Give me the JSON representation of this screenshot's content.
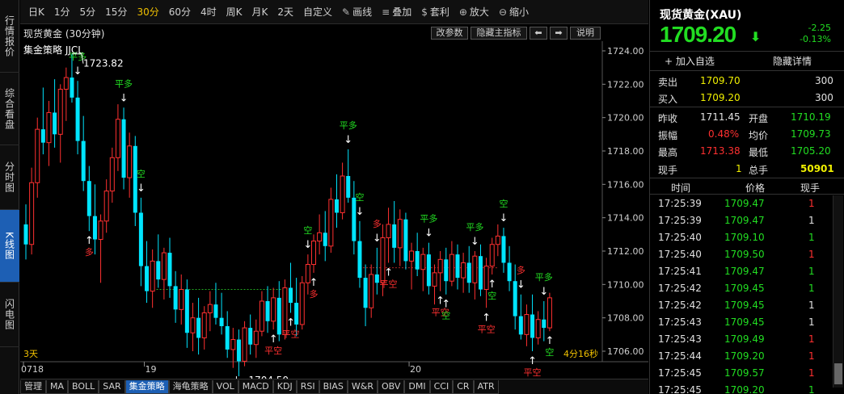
{
  "left_tabs": [
    "行情报价",
    "综合看盘",
    "分时图",
    "K线图",
    "闪电图"
  ],
  "toolbar": {
    "periods": [
      "日K",
      "1分",
      "5分",
      "15分",
      "30分",
      "60分",
      "4时",
      "周K",
      "月K",
      "2天",
      "自定义"
    ],
    "active_period": "30分",
    "tools": [
      {
        "icon": "pencil-icon",
        "glyph": "✎",
        "label": "画线"
      },
      {
        "icon": "layers-icon",
        "glyph": "≡",
        "label": "叠加"
      },
      {
        "icon": "money-bag-icon",
        "glyph": "$",
        "label": "套利"
      },
      {
        "icon": "zoom-in-icon",
        "glyph": "⊕",
        "label": "放大"
      },
      {
        "icon": "zoom-out-icon",
        "glyph": "⊖",
        "label": "缩小"
      }
    ]
  },
  "chart_header": {
    "title": "现货黄金 (30分钟)",
    "edit_params": "改参数",
    "hide_main": "隐藏主指标",
    "left_arrow": "⬅",
    "right_arrow": "➡",
    "help": "说明"
  },
  "strategy_label": "集金策略 JJCL",
  "chart_labels": {
    "left_bottom": "3天",
    "timer": "4分16秒"
  },
  "chart_data": {
    "type": "candlestick",
    "title": "现货黄金 (30分钟)",
    "y_ticks": [
      "1724.00",
      "1722.00",
      "1720.00",
      "1718.00",
      "1716.00",
      "1714.00",
      "1712.00",
      "1710.00",
      "1708.00",
      "1706.00"
    ],
    "ylim": [
      1704,
      1725
    ],
    "x_ticks": [
      {
        "label": "0718",
        "index": 0
      },
      {
        "label": "19",
        "index": 21
      },
      {
        "label": "20",
        "index": 67
      }
    ],
    "annotations": [
      {
        "label": "1723.82",
        "index": 8,
        "value": 1723.82,
        "kind": "high"
      },
      {
        "label": "1704.50",
        "index": 37,
        "value": 1704.5,
        "kind": "low"
      }
    ],
    "reference_line": 1709.7,
    "candles": [
      [
        1713.6,
        1714.8,
        1711.5,
        1712.4
      ],
      [
        1712.4,
        1717.0,
        1711.8,
        1716.1
      ],
      [
        1716.1,
        1720.0,
        1715.2,
        1719.3
      ],
      [
        1719.3,
        1721.8,
        1717.8,
        1718.5
      ],
      [
        1718.5,
        1721.0,
        1717.1,
        1720.3
      ],
      [
        1720.3,
        1722.3,
        1718.2,
        1719.0
      ],
      [
        1719.0,
        1722.0,
        1717.3,
        1721.7
      ],
      [
        1721.7,
        1723.0,
        1719.8,
        1722.4
      ],
      [
        1722.4,
        1723.8,
        1720.9,
        1721.2
      ],
      [
        1721.2,
        1722.2,
        1717.8,
        1718.6
      ],
      [
        1718.6,
        1720.1,
        1715.6,
        1716.2
      ],
      [
        1716.2,
        1717.1,
        1713.2,
        1714.1
      ],
      [
        1714.1,
        1716.0,
        1711.8,
        1712.7
      ],
      [
        1712.7,
        1714.2,
        1710.1,
        1713.8
      ],
      [
        1713.8,
        1716.3,
        1713.1,
        1715.6
      ],
      [
        1715.6,
        1718.2,
        1714.9,
        1717.6
      ],
      [
        1717.6,
        1720.8,
        1716.8,
        1719.9
      ],
      [
        1719.9,
        1720.6,
        1715.7,
        1716.4
      ],
      [
        1716.4,
        1719.1,
        1715.2,
        1718.3
      ],
      [
        1718.3,
        1718.9,
        1713.5,
        1714.3
      ],
      [
        1714.3,
        1715.2,
        1709.9,
        1711.1
      ],
      [
        1711.1,
        1712.6,
        1708.9,
        1709.6
      ],
      [
        1709.6,
        1712.1,
        1708.6,
        1711.4
      ],
      [
        1711.4,
        1713.0,
        1709.8,
        1710.3
      ],
      [
        1710.3,
        1712.2,
        1709.1,
        1711.9
      ],
      [
        1711.9,
        1712.8,
        1709.2,
        1709.9
      ],
      [
        1709.9,
        1710.8,
        1707.7,
        1708.5
      ],
      [
        1708.5,
        1710.6,
        1707.6,
        1709.7
      ],
      [
        1709.7,
        1710.3,
        1706.2,
        1707.1
      ],
      [
        1707.1,
        1708.9,
        1706.0,
        1708.0
      ],
      [
        1708.0,
        1709.2,
        1705.8,
        1706.8
      ],
      [
        1706.8,
        1708.7,
        1706.1,
        1708.3
      ],
      [
        1708.3,
        1709.6,
        1707.2,
        1708.8
      ],
      [
        1708.8,
        1710.1,
        1707.6,
        1708.0
      ],
      [
        1708.0,
        1709.5,
        1707.0,
        1707.5
      ],
      [
        1707.5,
        1708.4,
        1705.6,
        1706.1
      ],
      [
        1706.1,
        1707.4,
        1705.0,
        1706.7
      ],
      [
        1706.7,
        1707.3,
        1704.5,
        1705.4
      ],
      [
        1705.4,
        1707.8,
        1705.1,
        1707.4
      ],
      [
        1707.4,
        1708.2,
        1705.8,
        1706.4
      ],
      [
        1706.4,
        1707.9,
        1705.6,
        1707.2
      ],
      [
        1707.2,
        1709.6,
        1706.9,
        1709.0
      ],
      [
        1709.0,
        1709.9,
        1707.1,
        1707.8
      ],
      [
        1707.8,
        1709.8,
        1707.3,
        1709.2
      ],
      [
        1709.2,
        1710.2,
        1706.6,
        1707.0
      ],
      [
        1707.0,
        1710.3,
        1706.7,
        1709.8
      ],
      [
        1709.8,
        1711.3,
        1708.3,
        1708.9
      ],
      [
        1708.9,
        1710.4,
        1706.9,
        1707.6
      ],
      [
        1707.6,
        1710.5,
        1707.3,
        1710.1
      ],
      [
        1710.1,
        1711.8,
        1709.4,
        1711.2
      ],
      [
        1711.2,
        1713.0,
        1710.7,
        1712.6
      ],
      [
        1712.6,
        1714.2,
        1711.8,
        1713.1
      ],
      [
        1713.1,
        1714.4,
        1711.4,
        1712.3
      ],
      [
        1712.3,
        1715.8,
        1711.9,
        1715.1
      ],
      [
        1715.1,
        1716.6,
        1713.4,
        1714.3
      ],
      [
        1714.3,
        1717.3,
        1713.9,
        1716.5
      ],
      [
        1716.5,
        1718.1,
        1714.9,
        1715.2
      ],
      [
        1715.2,
        1716.2,
        1711.8,
        1712.6
      ],
      [
        1712.6,
        1713.8,
        1709.8,
        1710.4
      ],
      [
        1710.4,
        1711.2,
        1707.5,
        1708.6
      ],
      [
        1708.6,
        1711.2,
        1708.0,
        1710.6
      ],
      [
        1710.6,
        1712.2,
        1709.4,
        1710.1
      ],
      [
        1710.1,
        1713.6,
        1709.3,
        1712.8
      ],
      [
        1712.8,
        1714.6,
        1711.3,
        1713.6
      ],
      [
        1713.6,
        1715.0,
        1711.3,
        1712.2
      ],
      [
        1712.2,
        1714.5,
        1711.1,
        1713.9
      ],
      [
        1713.9,
        1714.3,
        1710.9,
        1711.4
      ],
      [
        1711.4,
        1712.5,
        1709.7,
        1712.0
      ],
      [
        1712.0,
        1713.1,
        1710.5,
        1710.9
      ],
      [
        1710.9,
        1712.2,
        1709.6,
        1711.8
      ],
      [
        1711.8,
        1712.5,
        1709.4,
        1709.9
      ],
      [
        1709.9,
        1711.2,
        1708.8,
        1710.7
      ],
      [
        1710.7,
        1712.0,
        1709.6,
        1711.5
      ],
      [
        1711.5,
        1712.2,
        1709.4,
        1710.2
      ],
      [
        1710.2,
        1712.6,
        1709.9,
        1711.8
      ],
      [
        1711.8,
        1712.4,
        1709.7,
        1710.4
      ],
      [
        1710.4,
        1711.9,
        1709.5,
        1711.3
      ],
      [
        1711.3,
        1712.3,
        1709.5,
        1710.1
      ],
      [
        1710.1,
        1712.0,
        1709.1,
        1711.7
      ],
      [
        1711.7,
        1712.4,
        1709.3,
        1709.7
      ],
      [
        1709.7,
        1711.6,
        1708.6,
        1711.1
      ],
      [
        1711.1,
        1712.8,
        1710.6,
        1712.4
      ],
      [
        1712.4,
        1713.6,
        1711.7,
        1712.9
      ],
      [
        1712.9,
        1713.4,
        1710.7,
        1711.3
      ],
      [
        1711.3,
        1712.3,
        1709.6,
        1710.2
      ],
      [
        1710.2,
        1711.2,
        1707.3,
        1708.1
      ],
      [
        1708.1,
        1709.4,
        1706.7,
        1707.0
      ],
      [
        1707.0,
        1708.8,
        1706.3,
        1708.2
      ],
      [
        1708.2,
        1709.4,
        1706.0,
        1706.8
      ],
      [
        1706.8,
        1708.4,
        1706.4,
        1707.9
      ],
      [
        1707.9,
        1709.0,
        1706.6,
        1707.4
      ],
      [
        1707.4,
        1709.5,
        1707.2,
        1709.2
      ]
    ],
    "signals": [
      {
        "index": 9,
        "arrow": "↓",
        "text": "平多",
        "side": "above",
        "color": "green"
      },
      {
        "index": 11,
        "arrow": "↑",
        "text": "多",
        "side": "below",
        "color": "red"
      },
      {
        "index": 17,
        "arrow": "↓",
        "text": "平多",
        "side": "above",
        "color": "green"
      },
      {
        "index": 20,
        "arrow": "↓",
        "text": "空",
        "side": "above",
        "color": "green"
      },
      {
        "index": 43,
        "arrow": "↑",
        "text": "平空",
        "side": "below",
        "color": "red"
      },
      {
        "index": 46,
        "arrow": "↑",
        "text": "平空",
        "side": "below",
        "color": "red"
      },
      {
        "index": 49,
        "arrow": "↓",
        "text": "空",
        "side": "above",
        "color": "green"
      },
      {
        "index": 50,
        "arrow": "↑",
        "text": "多",
        "side": "below",
        "color": "red"
      },
      {
        "index": 56,
        "arrow": "↓",
        "text": "平多",
        "side": "above",
        "color": "green"
      },
      {
        "index": 58,
        "arrow": "↓",
        "text": "空",
        "side": "above",
        "color": "green"
      },
      {
        "index": 61,
        "arrow": "↓",
        "text": "多",
        "side": "above",
        "color": "red"
      },
      {
        "index": 63,
        "arrow": "↑",
        "text": "平空",
        "side": "below",
        "color": "red"
      },
      {
        "index": 70,
        "arrow": "↓",
        "text": "平多",
        "side": "above",
        "color": "green"
      },
      {
        "index": 72,
        "arrow": "↑",
        "text": "平空",
        "side": "below",
        "color": "red"
      },
      {
        "index": 73,
        "arrow": "↑",
        "text": "空",
        "side": "below",
        "color": "green"
      },
      {
        "index": 78,
        "arrow": "↓",
        "text": "平多",
        "side": "above",
        "color": "green"
      },
      {
        "index": 80,
        "arrow": "↑",
        "text": "平空",
        "side": "below",
        "color": "red"
      },
      {
        "index": 81,
        "arrow": "↑",
        "text": "空",
        "side": "below",
        "color": "green"
      },
      {
        "index": 83,
        "arrow": "↓",
        "text": "空",
        "side": "above",
        "color": "green"
      },
      {
        "index": 86,
        "arrow": "↓",
        "text": "多",
        "side": "above",
        "color": "red"
      },
      {
        "index": 88,
        "arrow": "↑",
        "text": "平空",
        "side": "below",
        "color": "red"
      },
      {
        "index": 90,
        "arrow": "↓",
        "text": "平多",
        "side": "above",
        "color": "green"
      },
      {
        "index": 91,
        "arrow": "↑",
        "text": "空",
        "side": "below",
        "color": "green"
      }
    ],
    "colors": {
      "up": "#ff3030",
      "down": "#00e5ff",
      "ref_line": "#22aa22",
      "signal_green": "#22dd22",
      "signal_red": "#ff3030"
    }
  },
  "indicator_tabs": [
    "管理",
    "MA",
    "BOLL",
    "SAR",
    "集金策略",
    "海龟策略",
    "VOL",
    "MACD",
    "KDJ",
    "RSI",
    "BIAS",
    "W&R",
    "OBV",
    "DMI",
    "CCI",
    "CR",
    "ATR"
  ],
  "active_indicator": "集金策略",
  "quote": {
    "name": "现货黄金(XAU)",
    "price": "1709.20",
    "arrow": "⬇",
    "change": "-2.25",
    "change_pct": "-0.13%",
    "add_watch": "+ 加入自选",
    "hide_detail": "隐藏详情",
    "sell_label": "卖出",
    "sell_price": "1709.70",
    "sell_vol": "300",
    "buy_label": "买入",
    "buy_price": "1709.20",
    "buy_vol": "300",
    "prev_close_label": "昨收",
    "prev_close": "1711.45",
    "open_label": "开盘",
    "open": "1710.19",
    "amplitude_label": "振幅",
    "amplitude": "0.48%",
    "avg_label": "均价",
    "avg": "1709.73",
    "high_label": "最高",
    "high": "1713.38",
    "low_label": "最低",
    "low": "1705.20",
    "cur_vol_label": "现手",
    "cur_vol": "1",
    "total_vol_label": "总手",
    "total_vol": "50901",
    "ticks_header": {
      "time": "时间",
      "price": "价格",
      "vol": "现手"
    },
    "ticks": [
      {
        "time": "17:25:39",
        "price": "1709.47",
        "vol": "1",
        "vol_color": "red"
      },
      {
        "time": "17:25:39",
        "price": "1709.47",
        "vol": "1",
        "vol_color": "white"
      },
      {
        "time": "17:25:40",
        "price": "1709.10",
        "vol": "1",
        "vol_color": "green"
      },
      {
        "time": "17:25:40",
        "price": "1709.50",
        "vol": "1",
        "vol_color": "red"
      },
      {
        "time": "17:25:41",
        "price": "1709.47",
        "vol": "1",
        "vol_color": "green"
      },
      {
        "time": "17:25:42",
        "price": "1709.45",
        "vol": "1",
        "vol_color": "green"
      },
      {
        "time": "17:25:42",
        "price": "1709.45",
        "vol": "1",
        "vol_color": "white"
      },
      {
        "time": "17:25:43",
        "price": "1709.45",
        "vol": "1",
        "vol_color": "white"
      },
      {
        "time": "17:25:43",
        "price": "1709.49",
        "vol": "1",
        "vol_color": "red"
      },
      {
        "time": "17:25:44",
        "price": "1709.20",
        "vol": "1",
        "vol_color": "red"
      },
      {
        "time": "17:25:45",
        "price": "1709.57",
        "vol": "1",
        "vol_color": "red"
      },
      {
        "time": "17:25:45",
        "price": "1709.20",
        "vol": "1",
        "vol_color": "green"
      }
    ]
  }
}
